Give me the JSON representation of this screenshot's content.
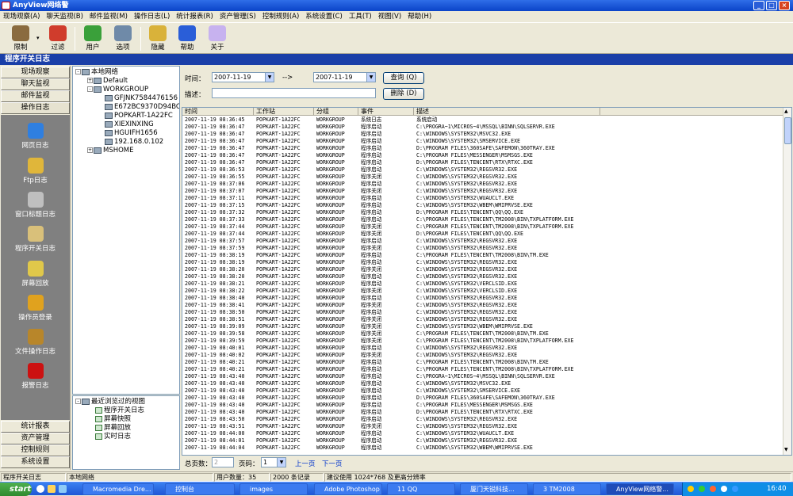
{
  "window": {
    "title": "AnyView网络警"
  },
  "menu": [
    "现场观察(A)",
    "聊天监视(B)",
    "邮件监视(M)",
    "操作日志(L)",
    "统计报表(R)",
    "资产管理(S)",
    "控制规则(A)",
    "系统设置(C)",
    "工具(T)",
    "视图(V)",
    "帮助(H)"
  ],
  "toolbar": [
    {
      "label": "限制",
      "icon": "house-icon",
      "color": "#8a6b3f"
    },
    {
      "label": "过滤",
      "icon": "lifebuoy-icon",
      "color": "#d03c2c"
    },
    {
      "label": "用户",
      "icon": "users-icon",
      "color": "#3aa03a"
    },
    {
      "label": "选项",
      "icon": "gears-icon",
      "color": "#6f8aa8"
    },
    {
      "label": "隐藏",
      "icon": "lock-icon",
      "color": "#d9b23a"
    },
    {
      "label": "帮助",
      "icon": "help-icon",
      "color": "#2a5ed8"
    },
    {
      "label": "关于",
      "icon": "bulb-icon",
      "color": "#c7b2ef"
    }
  ],
  "page_title": "程序开关日志",
  "nav_top": [
    "现场观察",
    "聊天监视",
    "邮件监视",
    "操作日志"
  ],
  "nav_icons": [
    {
      "label": "网页日志",
      "icon": "ie-icon",
      "color": "#2f7fe0"
    },
    {
      "label": "Ftp日志",
      "icon": "ftp-icon",
      "color": "#e0b63a"
    },
    {
      "label": "窗口标题日志",
      "icon": "window-icon",
      "color": "#bfbfbf"
    },
    {
      "label": "程序开关日志",
      "icon": "program-icon",
      "color": "#d9c07a"
    },
    {
      "label": "屏幕回放",
      "icon": "screen-replay-icon",
      "color": "#e0c84a"
    },
    {
      "label": "操作员登录",
      "icon": "operators-icon",
      "color": "#e0a21e"
    },
    {
      "label": "文件操作日志",
      "icon": "file-icon",
      "color": "#b8862a"
    },
    {
      "label": "报警日志",
      "icon": "alarm-icon",
      "color": "#cc1111"
    }
  ],
  "nav_bottom": [
    "统计报表",
    "资产管理",
    "控制规则",
    "系统设置"
  ],
  "tree": {
    "root": "本地网络",
    "groups": [
      "Default",
      "WORKGROUP",
      "MSHOME"
    ],
    "hosts": [
      "GFJNK7584476156",
      "E672BC9370D94BC",
      "POPKART-1A22FC",
      "XIEXINXING",
      "HGUIFH1656",
      "192.168.0.102"
    ]
  },
  "recent": {
    "title": "最近浏览过的视图",
    "items": [
      "程序开关日志",
      "屏幕快照",
      "屏幕回放",
      "实时日志"
    ]
  },
  "query": {
    "time_label": "时间：",
    "from": "2007-11-19",
    "arrow": "-->",
    "to": "2007-11-19",
    "desc_label": "描述：",
    "query_btn": "查询 (Q)",
    "delete_btn": "删除 (D)"
  },
  "columns": [
    "时间",
    "工作站",
    "分组",
    "事件",
    "描述"
  ],
  "rows": [
    [
      "2007-11-19 08:36:45",
      "POPKART-1A22FC",
      "WORKGROUP",
      "系统日志",
      "系统启动"
    ],
    [
      "2007-11-19 08:36:47",
      "POPKART-1A22FC",
      "WORKGROUP",
      "程序启动",
      "C:\\PROGRA~1\\MICROS~4\\MSSQL\\BINN\\SQLSERVR.EXE"
    ],
    [
      "2007-11-19 08:36:47",
      "POPKART-1A22FC",
      "WORKGROUP",
      "程序启动",
      "C:\\WINDOWS\\SYSTEM32\\MSVC32.EXE"
    ],
    [
      "2007-11-19 08:36:47",
      "POPKART-1A22FC",
      "WORKGROUP",
      "程序启动",
      "C:\\WINDOWS\\SYSTEM32\\SMSERVICE.EXE"
    ],
    [
      "2007-11-19 08:36:47",
      "POPKART-1A22FC",
      "WORKGROUP",
      "程序启动",
      "D:\\PROGRAM FILES\\360SAFE\\SAFEMON\\360TRAY.EXE"
    ],
    [
      "2007-11-19 08:36:47",
      "POPKART-1A22FC",
      "WORKGROUP",
      "程序启动",
      "C:\\PROGRAM FILES\\MESSENGER\\MSMSGS.EXE"
    ],
    [
      "2007-11-19 08:36:47",
      "POPKART-1A22FC",
      "WORKGROUP",
      "程序启动",
      "D:\\PROGRAM FILES\\TENCENT\\RTX\\RTXC.EXE"
    ],
    [
      "2007-11-19 08:36:53",
      "POPKART-1A22FC",
      "WORKGROUP",
      "程序启动",
      "C:\\WINDOWS\\SYSTEM32\\REGSVR32.EXE"
    ],
    [
      "2007-11-19 08:36:55",
      "POPKART-1A22FC",
      "WORKGROUP",
      "程序关闭",
      "C:\\WINDOWS\\SYSTEM32\\REGSVR32.EXE"
    ],
    [
      "2007-11-19 08:37:06",
      "POPKART-1A22FC",
      "WORKGROUP",
      "程序启动",
      "C:\\WINDOWS\\SYSTEM32\\REGSVR32.EXE"
    ],
    [
      "2007-11-19 08:37:07",
      "POPKART-1A22FC",
      "WORKGROUP",
      "程序关闭",
      "C:\\WINDOWS\\SYSTEM32\\REGSVR32.EXE"
    ],
    [
      "2007-11-19 08:37:11",
      "POPKART-1A22FC",
      "WORKGROUP",
      "程序启动",
      "C:\\WINDOWS\\SYSTEM32\\WUAUCLT.EXE"
    ],
    [
      "2007-11-19 08:37:15",
      "POPKART-1A22FC",
      "WORKGROUP",
      "程序启动",
      "C:\\WINDOWS\\SYSTEM32\\WBEM\\WMIPRVSE.EXE"
    ],
    [
      "2007-11-19 08:37:32",
      "POPKART-1A22FC",
      "WORKGROUP",
      "程序启动",
      "D:\\PROGRAM FILES\\TENCENT\\QQ\\QQ.EXE"
    ],
    [
      "2007-11-19 08:37:33",
      "POPKART-1A22FC",
      "WORKGROUP",
      "程序启动",
      "C:\\PROGRAM FILES\\TENCENT\\TM2008\\BIN\\TXPLATFORM.EXE"
    ],
    [
      "2007-11-19 08:37:44",
      "POPKART-1A22FC",
      "WORKGROUP",
      "程序关闭",
      "C:\\PROGRAM FILES\\TENCENT\\TM2008\\BIN\\TXPLATFORM.EXE"
    ],
    [
      "2007-11-19 08:37:44",
      "POPKART-1A22FC",
      "WORKGROUP",
      "程序关闭",
      "D:\\PROGRAM FILES\\TENCENT\\QQ\\QQ.EXE"
    ],
    [
      "2007-11-19 08:37:57",
      "POPKART-1A22FC",
      "WORKGROUP",
      "程序启动",
      "C:\\WINDOWS\\SYSTEM32\\REGSVR32.EXE"
    ],
    [
      "2007-11-19 08:37:59",
      "POPKART-1A22FC",
      "WORKGROUP",
      "程序关闭",
      "C:\\WINDOWS\\SYSTEM32\\REGSVR32.EXE"
    ],
    [
      "2007-11-19 08:38:19",
      "POPKART-1A22FC",
      "WORKGROUP",
      "程序启动",
      "C:\\PROGRAM FILES\\TENCENT\\TM2008\\BIN\\TM.EXE"
    ],
    [
      "2007-11-19 08:38:19",
      "POPKART-1A22FC",
      "WORKGROUP",
      "程序启动",
      "C:\\WINDOWS\\SYSTEM32\\REGSVR32.EXE"
    ],
    [
      "2007-11-19 08:38:20",
      "POPKART-1A22FC",
      "WORKGROUP",
      "程序关闭",
      "C:\\WINDOWS\\SYSTEM32\\REGSVR32.EXE"
    ],
    [
      "2007-11-19 08:38:20",
      "POPKART-1A22FC",
      "WORKGROUP",
      "程序启动",
      "C:\\WINDOWS\\SYSTEM32\\REGSVR32.EXE"
    ],
    [
      "2007-11-19 08:38:21",
      "POPKART-1A22FC",
      "WORKGROUP",
      "程序启动",
      "C:\\WINDOWS\\SYSTEM32\\VERCLSID.EXE"
    ],
    [
      "2007-11-19 08:38:22",
      "POPKART-1A22FC",
      "WORKGROUP",
      "程序关闭",
      "C:\\WINDOWS\\SYSTEM32\\VERCLSID.EXE"
    ],
    [
      "2007-11-19 08:38:40",
      "POPKART-1A22FC",
      "WORKGROUP",
      "程序启动",
      "C:\\WINDOWS\\SYSTEM32\\REGSVR32.EXE"
    ],
    [
      "2007-11-19 08:38:41",
      "POPKART-1A22FC",
      "WORKGROUP",
      "程序关闭",
      "C:\\WINDOWS\\SYSTEM32\\REGSVR32.EXE"
    ],
    [
      "2007-11-19 08:38:50",
      "POPKART-1A22FC",
      "WORKGROUP",
      "程序启动",
      "C:\\WINDOWS\\SYSTEM32\\REGSVR32.EXE"
    ],
    [
      "2007-11-19 08:38:51",
      "POPKART-1A22FC",
      "WORKGROUP",
      "程序关闭",
      "C:\\WINDOWS\\SYSTEM32\\REGSVR32.EXE"
    ],
    [
      "2007-11-19 08:39:09",
      "POPKART-1A22FC",
      "WORKGROUP",
      "程序关闭",
      "C:\\WINDOWS\\SYSTEM32\\WBEM\\WMIPRVSE.EXE"
    ],
    [
      "2007-11-19 08:39:58",
      "POPKART-1A22FC",
      "WORKGROUP",
      "程序关闭",
      "C:\\PROGRAM FILES\\TENCENT\\TM2008\\BIN\\TM.EXE"
    ],
    [
      "2007-11-19 08:39:59",
      "POPKART-1A22FC",
      "WORKGROUP",
      "程序关闭",
      "C:\\PROGRAM FILES\\TENCENT\\TM2008\\BIN\\TXPLATFORM.EXE"
    ],
    [
      "2007-11-19 08:40:01",
      "POPKART-1A22FC",
      "WORKGROUP",
      "程序启动",
      "C:\\WINDOWS\\SYSTEM32\\REGSVR32.EXE"
    ],
    [
      "2007-11-19 08:40:02",
      "POPKART-1A22FC",
      "WORKGROUP",
      "程序关闭",
      "C:\\WINDOWS\\SYSTEM32\\REGSVR32.EXE"
    ],
    [
      "2007-11-19 08:40:21",
      "POPKART-1A22FC",
      "WORKGROUP",
      "程序启动",
      "C:\\PROGRAM FILES\\TENCENT\\TM2008\\BIN\\TM.EXE"
    ],
    [
      "2007-11-19 08:40:21",
      "POPKART-1A22FC",
      "WORKGROUP",
      "程序启动",
      "C:\\PROGRAM FILES\\TENCENT\\TM2008\\BIN\\TXPLATFORM.EXE"
    ],
    [
      "2007-11-19 08:43:40",
      "POPKART-1A22FC",
      "WORKGROUP",
      "程序启动",
      "C:\\PROGRA~1\\MICROS~4\\MSSQL\\BINN\\SQLSERVR.EXE"
    ],
    [
      "2007-11-19 08:43:40",
      "POPKART-1A22FC",
      "WORKGROUP",
      "程序启动",
      "C:\\WINDOWS\\SYSTEM32\\MSVC32.EXE"
    ],
    [
      "2007-11-19 08:43:40",
      "POPKART-1A22FC",
      "WORKGROUP",
      "程序启动",
      "C:\\WINDOWS\\SYSTEM32\\SMSERVICE.EXE"
    ],
    [
      "2007-11-19 08:43:40",
      "POPKART-1A22FC",
      "WORKGROUP",
      "程序启动",
      "D:\\PROGRAM FILES\\360SAFE\\SAFEMON\\360TRAY.EXE"
    ],
    [
      "2007-11-19 08:43:40",
      "POPKART-1A22FC",
      "WORKGROUP",
      "程序启动",
      "C:\\PROGRAM FILES\\MESSENGER\\MSMSGS.EXE"
    ],
    [
      "2007-11-19 08:43:40",
      "POPKART-1A22FC",
      "WORKGROUP",
      "程序启动",
      "D:\\PROGRAM FILES\\TENCENT\\RTX\\RTXC.EXE"
    ],
    [
      "2007-11-19 08:43:50",
      "POPKART-1A22FC",
      "WORKGROUP",
      "程序启动",
      "C:\\WINDOWS\\SYSTEM32\\REGSVR32.EXE"
    ],
    [
      "2007-11-19 08:43:51",
      "POPKART-1A22FC",
      "WORKGROUP",
      "程序关闭",
      "C:\\WINDOWS\\SYSTEM32\\REGSVR32.EXE"
    ],
    [
      "2007-11-19 08:44:00",
      "POPKART-1A22FC",
      "WORKGROUP",
      "程序启动",
      "C:\\WINDOWS\\SYSTEM32\\WUAUCLT.EXE"
    ],
    [
      "2007-11-19 08:44:01",
      "POPKART-1A22FC",
      "WORKGROUP",
      "程序启动",
      "C:\\WINDOWS\\SYSTEM32\\REGSVR32.EXE"
    ],
    [
      "2007-11-19 08:44:04",
      "POPKART-1A22FC",
      "WORKGROUP",
      "程序启动",
      "C:\\WINDOWS\\SYSTEM32\\WBEM\\WMIPRVSE.EXE"
    ]
  ],
  "pager": {
    "total_label": "总页数：",
    "total": "2",
    "page_label": "页码：",
    "page": "1",
    "prev": "上一页",
    "next": "下一页"
  },
  "status": [
    "程序开关日志",
    "本地网络",
    "用户数量：35",
    "2000 条记录",
    "建议使用 1024*768 及更高分辨率"
  ],
  "taskbar": {
    "start": "start",
    "items": [
      "Macromedia Dre...",
      "控制台",
      "images",
      "Adobe Photoshop",
      "11 QQ",
      "厦门天锐科技...",
      "3 TM2008",
      "AnyView网络警..."
    ],
    "clock": "16:40"
  }
}
